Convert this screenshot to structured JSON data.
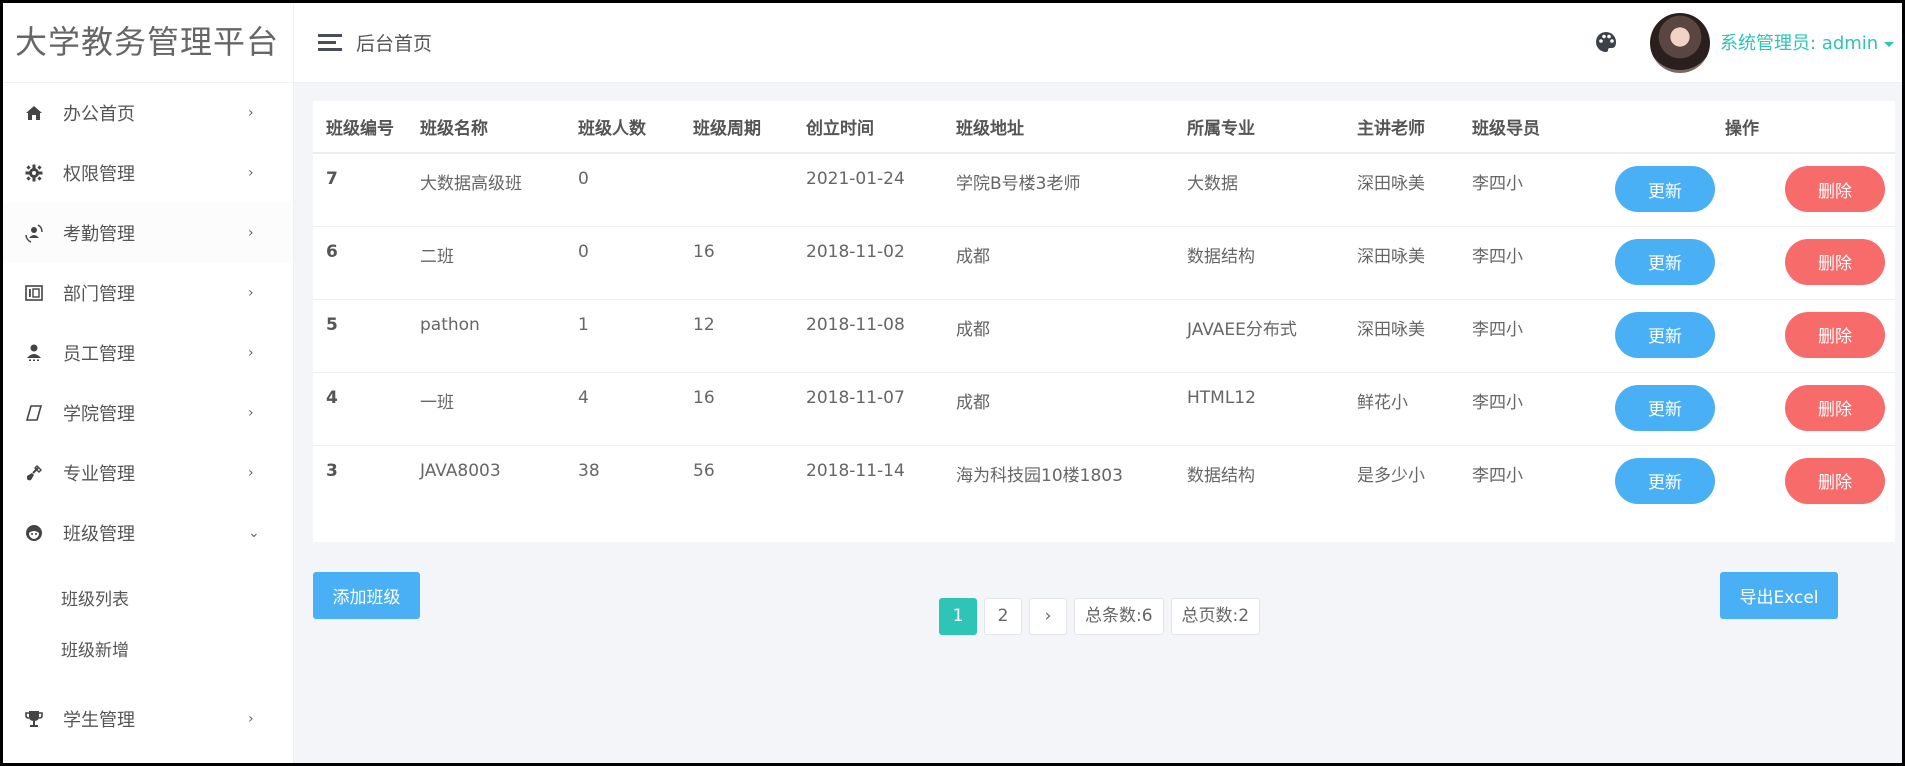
{
  "app": {
    "title": "大学教务管理平台"
  },
  "header": {
    "breadcrumb": "后台首页",
    "user_label": "系统管理员: admin"
  },
  "sidebar": {
    "items": [
      {
        "label": "办公首页",
        "icon": "home-icon",
        "arrow": "›"
      },
      {
        "label": "权限管理",
        "icon": "gear-icon",
        "arrow": "›"
      },
      {
        "label": "考勤管理",
        "icon": "attendance-icon",
        "arrow": "›"
      },
      {
        "label": "部门管理",
        "icon": "department-icon",
        "arrow": "›"
      },
      {
        "label": "员工管理",
        "icon": "user-icon",
        "arrow": "›"
      },
      {
        "label": "学院管理",
        "icon": "college-icon",
        "arrow": "›"
      },
      {
        "label": "专业管理",
        "icon": "major-icon",
        "arrow": "›"
      },
      {
        "label": "班级管理",
        "icon": "class-icon",
        "arrow": "⌄",
        "expanded": true,
        "children": [
          {
            "label": "班级列表"
          },
          {
            "label": "班级新增"
          }
        ]
      },
      {
        "label": "学生管理",
        "icon": "trophy-icon",
        "arrow": "›"
      }
    ]
  },
  "table": {
    "columns": [
      "班级编号",
      "班级名称",
      "班级人数",
      "班级周期",
      "创立时间",
      "班级地址",
      "所属专业",
      "主讲老师",
      "班级导员",
      "操作"
    ],
    "rows": [
      {
        "id": "7",
        "name": "大数据高级班",
        "count": "0",
        "period": "",
        "created": "2021-01-24",
        "address": "学院B号楼3老师",
        "major": "大数据",
        "teacher": "深田咏美",
        "counselor": "李四小"
      },
      {
        "id": "6",
        "name": "二班",
        "count": "0",
        "period": "16",
        "created": "2018-11-02",
        "address": "成都",
        "major": "数据结构",
        "teacher": "深田咏美",
        "counselor": "李四小"
      },
      {
        "id": "5",
        "name": "pathon",
        "count": "1",
        "period": "12",
        "created": "2018-11-08",
        "address": "成都",
        "major": "JAVAEE分布式",
        "teacher": "深田咏美",
        "counselor": "李四小"
      },
      {
        "id": "4",
        "name": "一班",
        "count": "4",
        "period": "16",
        "created": "2018-11-07",
        "address": "成都",
        "major": "HTML12",
        "teacher": "鲜花小",
        "counselor": "李四小"
      },
      {
        "id": "3",
        "name": "JAVA8003",
        "count": "38",
        "period": "56",
        "created": "2018-11-14",
        "address": "海为科技园10楼1803",
        "major": "数据结构",
        "teacher": "是多少小",
        "counselor": "李四小"
      }
    ],
    "update_label": "更新",
    "delete_label": "删除"
  },
  "toolbar": {
    "add_label": "添加班级",
    "export_label": "导出Excel"
  },
  "pagination": {
    "pages": [
      "1",
      "2"
    ],
    "current": "1",
    "next": "›",
    "total_items": "总条数:6",
    "total_pages": "总页数:2"
  },
  "colors": {
    "primary": "#4ab0f5",
    "danger": "#f76b6b",
    "accent": "#2ec4b6"
  }
}
